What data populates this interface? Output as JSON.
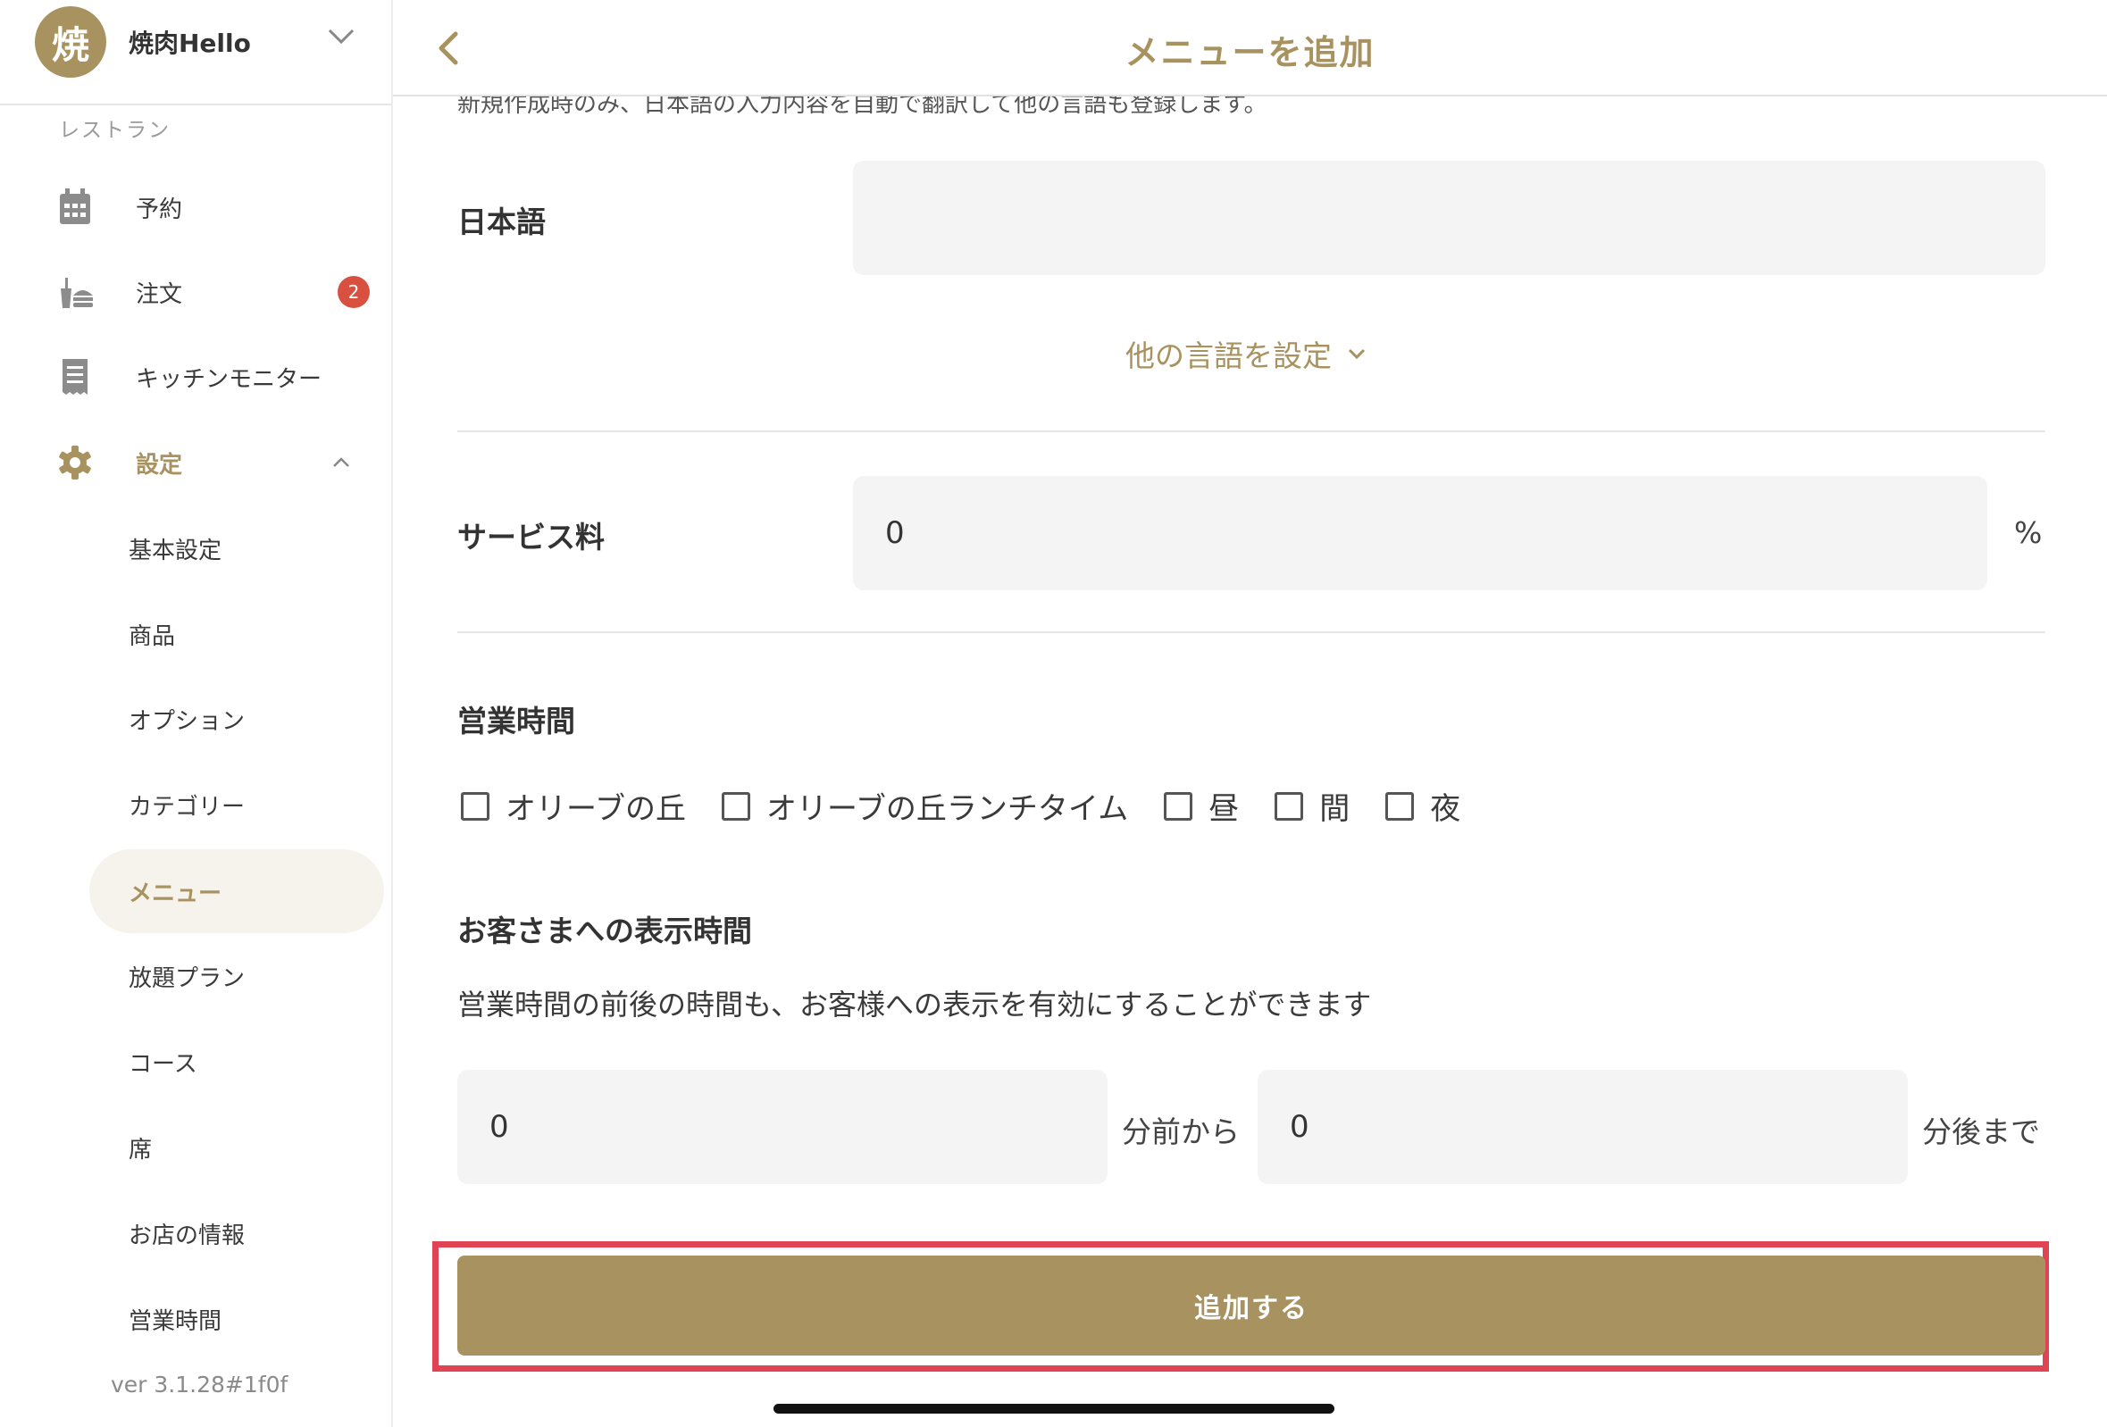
{
  "store": {
    "logo_char": "焼",
    "name": "焼肉Hello"
  },
  "sidebar": {
    "section_label": "レストラン",
    "items": [
      {
        "label": "予約",
        "icon": "calendar-icon"
      },
      {
        "label": "注文",
        "icon": "food-order-icon",
        "badge": "2"
      },
      {
        "label": "キッチンモニター",
        "icon": "receipt-icon"
      },
      {
        "label": "設定",
        "icon": "gear-icon",
        "expanded": true
      }
    ],
    "sub_items": [
      {
        "label": "基本設定"
      },
      {
        "label": "商品"
      },
      {
        "label": "オプション"
      },
      {
        "label": "カテゴリー"
      },
      {
        "label": "メニュー",
        "active": true
      },
      {
        "label": "放題プラン"
      },
      {
        "label": "コース"
      },
      {
        "label": "席"
      },
      {
        "label": "お店の情報"
      },
      {
        "label": "営業時間"
      }
    ],
    "version": "ver 3.1.28#1f0f"
  },
  "header": {
    "title": "メニューを追加"
  },
  "form": {
    "translate_note": "新規作成時のみ、日本語の入力内容を自動で翻訳して他の言語も登録します。",
    "japanese_label": "日本語",
    "japanese_value": "",
    "other_languages_label": "他の言語を設定",
    "service_fee_label": "サービス料",
    "service_fee_value": "0",
    "service_fee_unit": "%",
    "business_hours_label": "営業時間",
    "business_hours_options": [
      {
        "label": "オリーブの丘",
        "checked": false
      },
      {
        "label": "オリーブの丘ランチタイム",
        "checked": false
      },
      {
        "label": "昼",
        "checked": false
      },
      {
        "label": "間",
        "checked": false
      },
      {
        "label": "夜",
        "checked": false
      }
    ],
    "display_time_label": "お客さまへの表示時間",
    "display_time_desc": "営業時間の前後の時間も、お客様への表示を有効にすることができます",
    "before_value": "0",
    "before_unit": "分前から",
    "after_value": "0",
    "after_unit": "分後まで",
    "submit_label": "追加する"
  },
  "colors": {
    "accent": "#a8925f",
    "badge": "#d85140",
    "highlight": "#e04354"
  }
}
